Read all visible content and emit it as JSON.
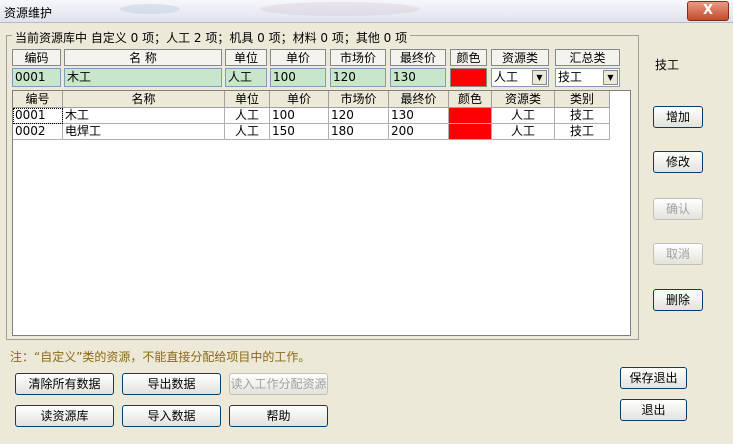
{
  "window": {
    "title": "资源维护",
    "close": "X"
  },
  "group_title": "当前资源库中 自定义 0 项；人工 2 项；机具 0 项；材料 0 项；其他 0 项",
  "form": {
    "headers": [
      "编码",
      "名 称",
      "单位",
      "单价",
      "市场价",
      "最终价",
      "颜色",
      "资源类",
      "汇总类"
    ],
    "code": "0001",
    "name": "木工",
    "unit": "人工",
    "price": "100",
    "market_price": "120",
    "final_price": "130",
    "color": "#ff0000",
    "resource_type": "人工",
    "summary_type": "技工"
  },
  "side_label": "技工",
  "table": {
    "columns": [
      "编号",
      "名称",
      "单位",
      "单价",
      "市场价",
      "最终价",
      "颜色",
      "资源类",
      "类别"
    ],
    "rows": [
      {
        "code": "0001",
        "name": "木工",
        "unit": "人工",
        "price": "100",
        "market": "120",
        "final": "130",
        "color": "#ff0000",
        "rtype": "人工",
        "category": "技工"
      },
      {
        "code": "0002",
        "name": "电焊工",
        "unit": "人工",
        "price": "150",
        "market": "180",
        "final": "200",
        "color": "#ff0000",
        "rtype": "人工",
        "category": "技工"
      }
    ]
  },
  "side_buttons": {
    "add": "增加",
    "edit": "修改",
    "confirm": "确认",
    "cancel": "取消",
    "delete": "删除"
  },
  "note": "注：“自定义”类的资源，不能直接分配给项目中的工作。",
  "bottom_buttons": {
    "clear_all": "清除所有数据",
    "export": "导出数据",
    "import_assign": "读入工作分配资源",
    "read_lib": "读资源库",
    "import": "导入数据",
    "help": "帮助",
    "save_exit": "保存退出",
    "exit": "退出"
  }
}
